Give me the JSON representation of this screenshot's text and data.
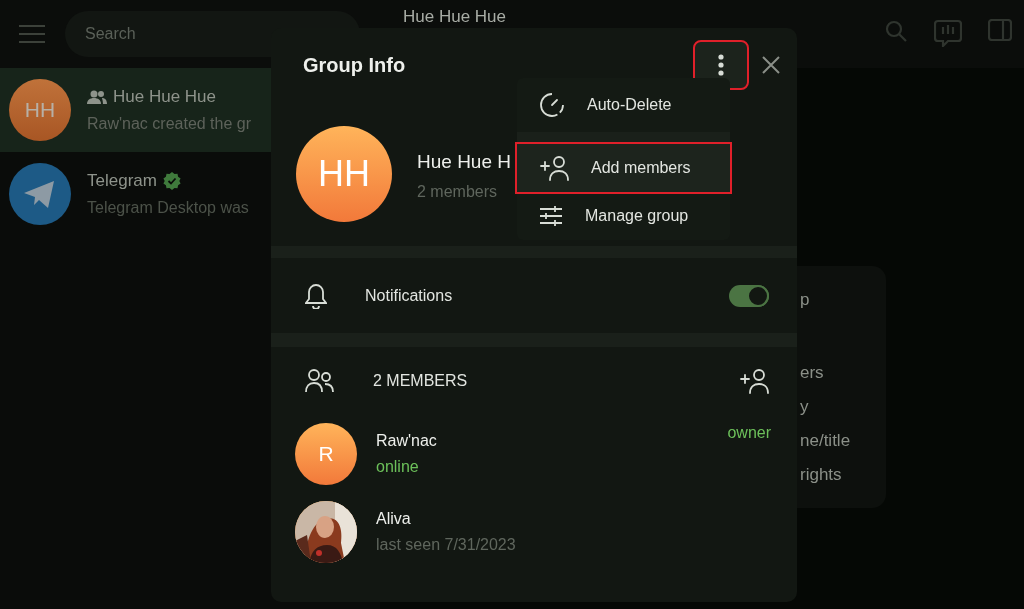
{
  "header": {
    "search": {
      "placeholder": "Search"
    },
    "title": "Hue Hue Hue"
  },
  "chats": [
    {
      "kind": "group",
      "name": "Hue Hue Hue",
      "preview": "Raw'nac created the gr",
      "avatar": "HH",
      "verified": false,
      "selected": true
    },
    {
      "kind": "bot",
      "name": "Telegram",
      "preview": "Telegram Desktop was",
      "verified": true,
      "selected": false
    }
  ],
  "background_card": {
    "lines": [
      "p",
      "ers",
      "y",
      "ne/title",
      "rights"
    ]
  },
  "modal": {
    "title": "Group Info",
    "menu_button": {
      "highlighted": true
    },
    "group": {
      "avatar": "HH",
      "name": "Hue Hue H",
      "subtitle": "2 members"
    },
    "notifications": {
      "label": "Notifications",
      "on": true
    },
    "members_header": "2 MEMBERS",
    "members": [
      {
        "name": "Raw'nac",
        "status": "online",
        "online": true,
        "role": "owner",
        "avatar": {
          "kind": "initials",
          "text": "R"
        }
      },
      {
        "name": "Aliva",
        "status": "last seen 7/31/2023",
        "online": false
      }
    ]
  },
  "menu": [
    {
      "kind": "timer",
      "label": "Auto-Delete",
      "highlighted": false
    },
    {
      "kind": "add",
      "label": "Add members",
      "highlighted": true
    },
    {
      "kind": "manage",
      "label": "Manage group",
      "highlighted": false
    }
  ]
}
